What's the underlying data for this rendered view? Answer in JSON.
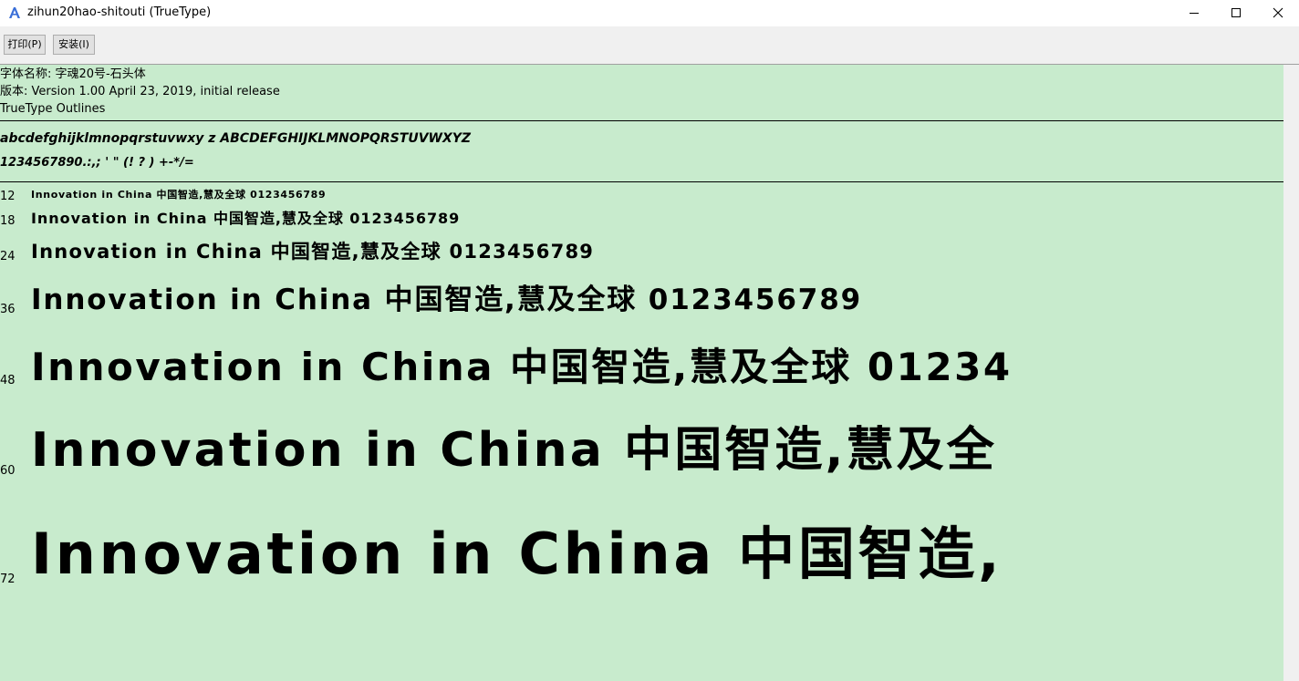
{
  "window": {
    "title": "zihun20hao-shitouti (TrueType)"
  },
  "toolbar": {
    "print_label": "打印(P)",
    "install_label": "安装(I)"
  },
  "font_info": {
    "name_line": "字体名称: 字魂20号-石头体",
    "version_line": "版本: Version 1.00 April 23, 2019, initial release",
    "type_line": "TrueType Outlines"
  },
  "charset": {
    "line1": "abcdefghijklmnopqrstuvwxy z    ABCDEFGHIJKLMNOPQRSTUVWXYZ",
    "line2": "1234567890.:,;   '   \"   (! ? )    +-*/="
  },
  "samples": [
    {
      "size": "12",
      "text": "Innovation   in   China   中国智造,慧及全球   0123456789"
    },
    {
      "size": "18",
      "text": "Innovation   in   China   中国智造,慧及全球   0123456789"
    },
    {
      "size": "24",
      "text": "Innovation   in   China   中国智造,慧及全球   0123456789"
    },
    {
      "size": "36",
      "text": "Innovation   in   China   中国智造,慧及全球   0123456789"
    },
    {
      "size": "48",
      "text": "Innovation   in   China   中国智造,慧及全球   01234"
    },
    {
      "size": "60",
      "text": "Innovation   in   China   中国智造,慧及全"
    },
    {
      "size": "72",
      "text": "Innovation   in   China   中国智造,"
    }
  ],
  "colors": {
    "preview_background": "#c8ebcd",
    "toolbar_background": "#f0f0f0"
  },
  "icons": {
    "app": "font-viewer-icon",
    "minimize": "minimize-icon",
    "maximize": "maximize-icon",
    "close": "close-icon"
  }
}
